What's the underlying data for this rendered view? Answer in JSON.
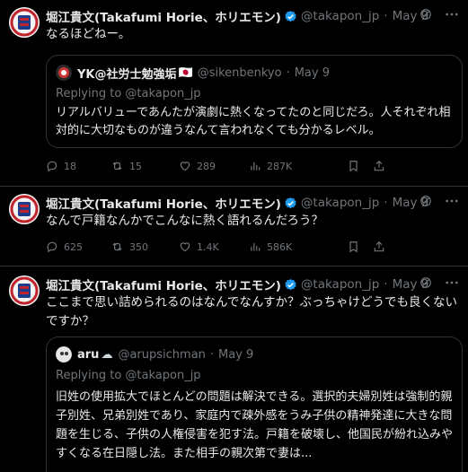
{
  "tweets": [
    {
      "author_name": "堀江貴文(Takafumi Horie、ホリエモン)",
      "handle": "@takapon_jp",
      "time": "May 9",
      "text": "なるほどねー。",
      "quote": {
        "author_name": "YK@社労士勉強垢",
        "flag": "🇯🇵",
        "handle": "@sikenbenkyo",
        "time": "May 9",
        "replying_to": "Replying to @takapon_jp",
        "text": "リアルバリューであんたが演劇に熱くなってたのと同じだろ。人それぞれ相対的に大切なものが違うなんて言われなくても分かるレベル。"
      },
      "replies": "18",
      "reposts": "15",
      "likes": "289",
      "views": "287K"
    },
    {
      "author_name": "堀江貴文(Takafumi Horie、ホリエモン)",
      "handle": "@takapon_jp",
      "time": "May 9",
      "text": "なんで戸籍なんかでこんなに熱く語れるんだろう？",
      "replies": "625",
      "reposts": "350",
      "likes": "1.4K",
      "views": "586K"
    },
    {
      "author_name": "堀江貴文(Takafumi Horie、ホリエモン)",
      "handle": "@takapon_jp",
      "time": "May 9",
      "text": "ここまで思い詰められるのはなんでなんすか？ぶっちゃけどうでも良くないですか？",
      "quote": {
        "author_name": "aru",
        "flag": "☁",
        "handle": "@arupsichman",
        "time": "May 9",
        "replying_to": "Replying to @takapon_jp",
        "text": "旧姓の使用拡大でほとんどの問題は解決できる。選択的夫婦別姓は強制的親子別姓、兄弟別姓であり、家庭内で疎外感をうみ子供の精神発達に大きな問題を生じる、子供の人権侵害を犯す法。戸籍を破壊し、他国民が紛れ込みやすくなる在日隠し法。また相手の親次第で妻は..."
      }
    }
  ],
  "icons": {
    "verified": "verified-badge-icon",
    "grok": "grok-icon",
    "more": "more-dots-icon",
    "reply": "reply-icon",
    "repost": "repost-icon",
    "like": "like-icon",
    "views": "views-icon",
    "bookmark": "bookmark-icon",
    "share": "share-icon"
  },
  "colors": {
    "background": "#000000",
    "text": "#e7e9ea",
    "muted": "#71767b",
    "border": "#2f3336",
    "verified": "#1d9bf0"
  }
}
